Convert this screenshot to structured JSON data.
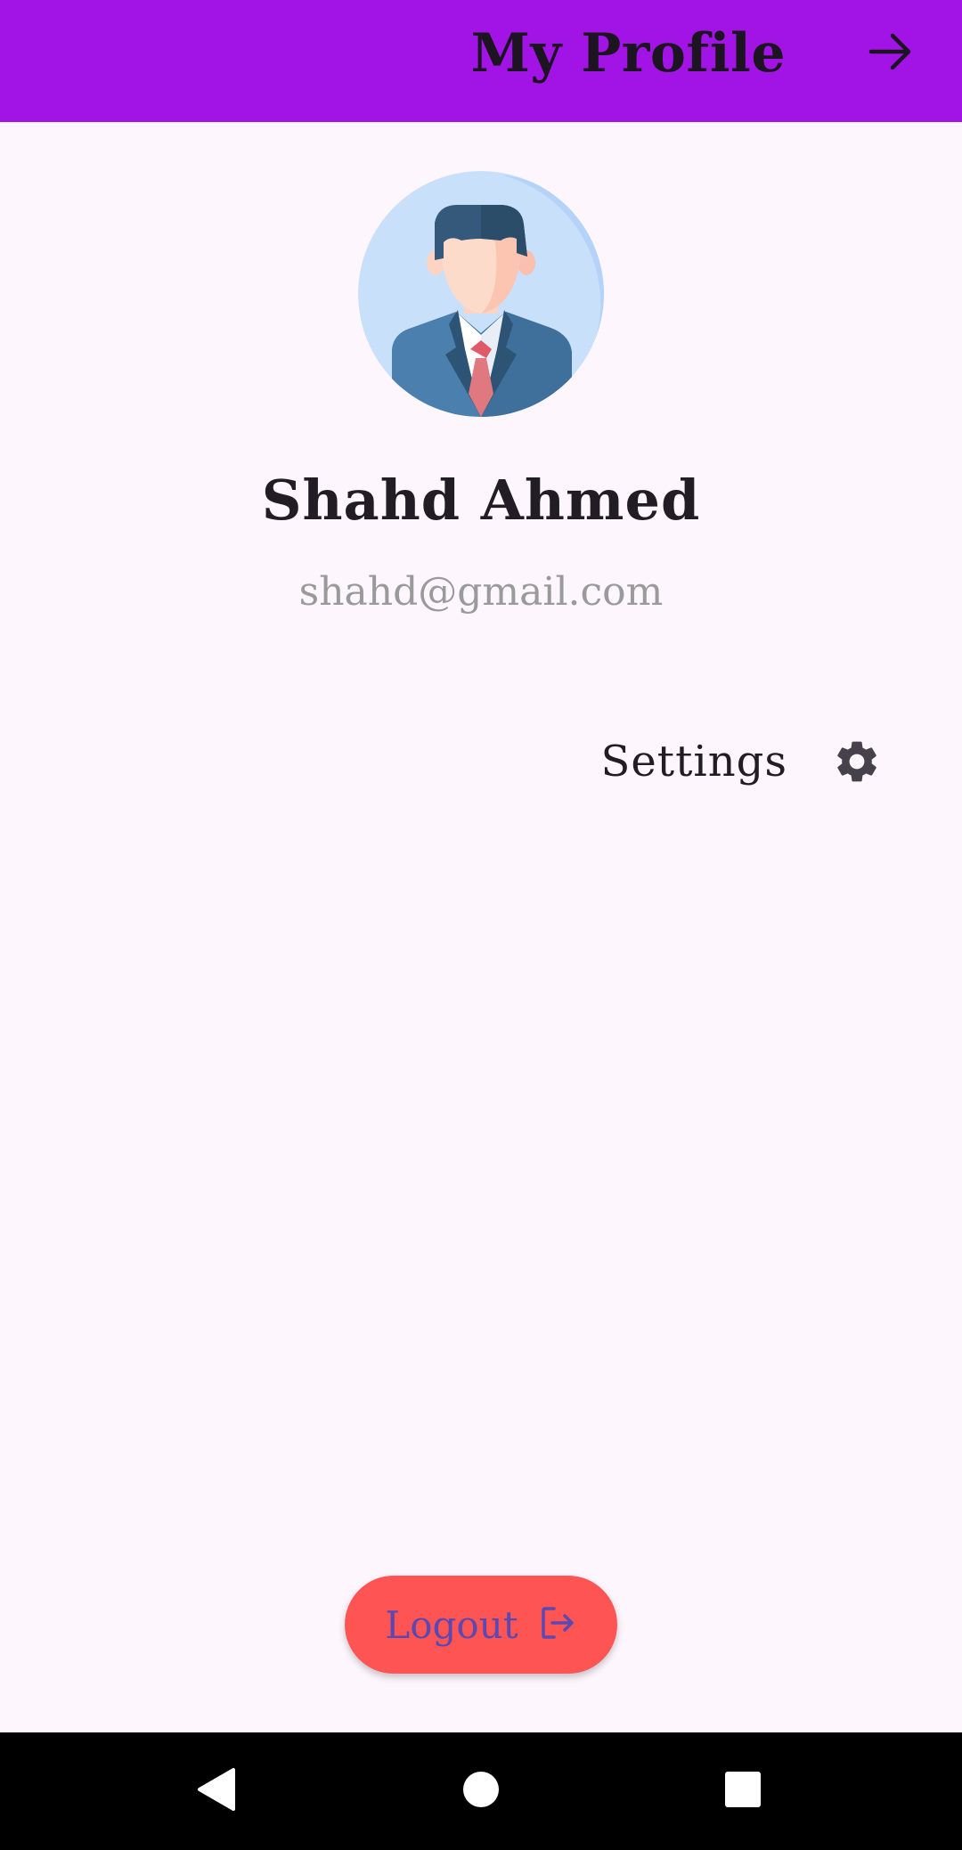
{
  "appbar": {
    "title": "My Profile",
    "action_icon": "arrow-right-icon",
    "background": "#a214e6"
  },
  "profile": {
    "avatar_icon": "businessman-avatar",
    "name": "Shahd Ahmed",
    "email": "shahd@gmail.com"
  },
  "settings": {
    "label": "Settings",
    "icon": "gear-icon"
  },
  "logout": {
    "label": "Logout",
    "icon": "logout-icon",
    "background": "#ff5454"
  },
  "system_nav": {
    "back_icon": "back-triangle-icon",
    "home_icon": "home-circle-icon",
    "recents_icon": "recents-square-icon"
  }
}
